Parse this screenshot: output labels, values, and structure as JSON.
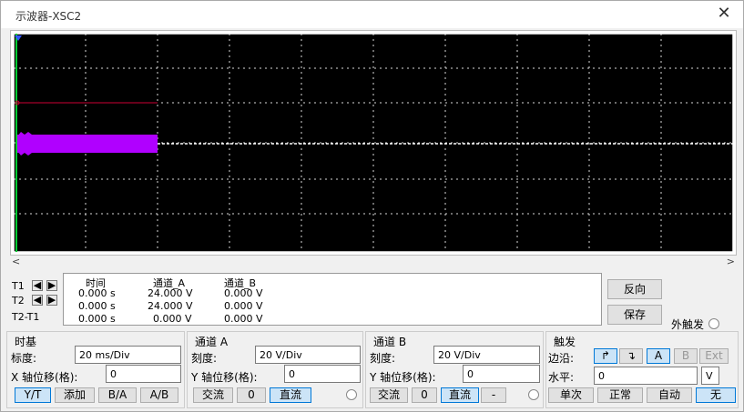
{
  "window": {
    "title": "示波器-XSC2",
    "close_glyph": "✕"
  },
  "scope": {
    "trace_color": "#b000ff",
    "marker_color": "#cc0033",
    "grid_color": "#ffffff"
  },
  "readout": {
    "rows": [
      "T1",
      "T2",
      "T2-T1"
    ],
    "headers": [
      "时间",
      "通道_A",
      "通道_B"
    ],
    "values": [
      [
        "0.000 s",
        "24.000 V",
        "0.000 V"
      ],
      [
        "0.000 s",
        "24.000 V",
        "0.000 V"
      ],
      [
        "0.000 s",
        "0.000 V",
        "0.000 V"
      ]
    ]
  },
  "side": {
    "reverse": "反向",
    "save": "保存",
    "ext_trigger": "外触发"
  },
  "timebase": {
    "title": "时基",
    "scale_label": "标度:",
    "scale_value": "20 ms/Div",
    "xpos_label": "X 轴位移(格):",
    "xpos_value": "0",
    "buttons": [
      "Y/T",
      "添加",
      "B/A",
      "A/B"
    ]
  },
  "chA": {
    "title": "通道 A",
    "scale_label": "刻度:",
    "scale_value": "20  V/Div",
    "ypos_label": "Y 轴位移(格):",
    "ypos_value": "0",
    "buttons": [
      "交流",
      "0",
      "直流"
    ]
  },
  "chB": {
    "title": "通道 B",
    "scale_label": "刻度:",
    "scale_value": "20  V/Div",
    "ypos_label": "Y 轴位移(格):",
    "ypos_value": "0",
    "buttons": [
      "交流",
      "0",
      "直流",
      "-"
    ]
  },
  "trigger": {
    "title": "触发",
    "edge_label": "边沿:",
    "edge_buttons": [
      "↱",
      "↴",
      "A",
      "B",
      "Ext"
    ],
    "level_label": "水平:",
    "level_value": "0",
    "level_unit": "V",
    "mode_buttons": [
      "单次",
      "正常",
      "自动",
      "无"
    ]
  }
}
